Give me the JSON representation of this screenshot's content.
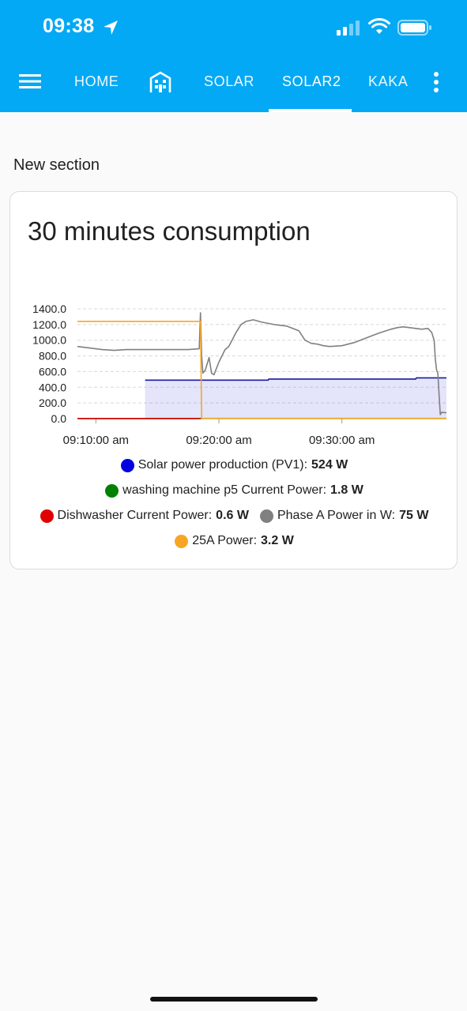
{
  "status_bar": {
    "time": "09:38"
  },
  "nav": {
    "tabs": [
      {
        "label": "HOME"
      },
      {
        "label": "SOLAR"
      },
      {
        "label": "SOLAR2",
        "active": true
      },
      {
        "label": "KAKA"
      }
    ],
    "icons": [
      "menu-icon",
      "building-icon",
      "more-vert-icon"
    ]
  },
  "section": {
    "title": "New section"
  },
  "card": {
    "title": "30 minutes consumption",
    "legend": [
      {
        "label": "Solar power production (PV1):",
        "value": "524 W",
        "color": "#0000e0"
      },
      {
        "label": "washing machine p5 Current Power:",
        "value": "1.8 W",
        "color": "#008000"
      },
      {
        "label": "Dishwasher Current Power:",
        "value": "0.6 W",
        "color": "#e00000"
      },
      {
        "label": "Phase A Power in W:",
        "value": "75 W",
        "color": "#808080"
      },
      {
        "label": "25A Power:",
        "value": "3.2 W",
        "color": "#f6a623"
      }
    ]
  },
  "chart_data": {
    "type": "line",
    "y_ticks": [
      "1400.0",
      "1200.0",
      "1000.0",
      "800.0",
      "600.0",
      "400.0",
      "200.0",
      "0.0"
    ],
    "x_ticks": [
      "09:10:00 am",
      "09:20:00 am",
      "09:30:00 am"
    ],
    "ylim": [
      0,
      1400
    ],
    "xlim_minutes": [
      8.5,
      38.5
    ],
    "grid": true,
    "series": [
      {
        "name": "Solar power production (PV1)",
        "color": "#1a1aa0",
        "fill": "rgba(90,90,230,0.16)",
        "x": [
          14,
          24,
          24.05,
          36,
          36.05,
          38.5
        ],
        "y": [
          490,
          490,
          505,
          505,
          520,
          520
        ]
      },
      {
        "name": "washing machine p5 Current Power",
        "color": "#008000",
        "x": [
          8.5,
          38.5
        ],
        "y": [
          2,
          2
        ]
      },
      {
        "name": "Dishwasher Current Power",
        "color": "#e00000",
        "x": [
          8.5,
          18.5
        ],
        "y": [
          1,
          1
        ]
      },
      {
        "name": "Phase A Power in W",
        "color": "#808080",
        "x": [
          8.5,
          9.5,
          10.5,
          11.5,
          12.5,
          14,
          16,
          17.5,
          18.4,
          18.5,
          18.6,
          18.7,
          18.9,
          19.2,
          19.4,
          19.6,
          20,
          20.5,
          20.8,
          21,
          21.4,
          21.8,
          22.2,
          22.8,
          23.5,
          24.5,
          25.5,
          26.5,
          27,
          27.5,
          28,
          28.5,
          29,
          30,
          31,
          32,
          33,
          34,
          34.5,
          35,
          35.5,
          36,
          36.5,
          37,
          37.3,
          37.5,
          37.6,
          37.7,
          37.8,
          37.9,
          38,
          38.1,
          38.5
        ],
        "y": [
          920,
          900,
          880,
          870,
          880,
          880,
          880,
          880,
          890,
          1350,
          800,
          580,
          620,
          780,
          580,
          560,
          720,
          880,
          920,
          980,
          1100,
          1200,
          1240,
          1260,
          1230,
          1200,
          1180,
          1120,
          1000,
          960,
          950,
          930,
          920,
          930,
          970,
          1030,
          1090,
          1140,
          1160,
          1170,
          1160,
          1150,
          1140,
          1150,
          1100,
          1000,
          750,
          620,
          580,
          300,
          50,
          80,
          75
        ]
      },
      {
        "name": "25A Power",
        "color": "#f6a623",
        "x": [
          8.5,
          18.5,
          18.6,
          38.5
        ],
        "y": [
          1240,
          1240,
          3,
          3
        ]
      }
    ]
  }
}
